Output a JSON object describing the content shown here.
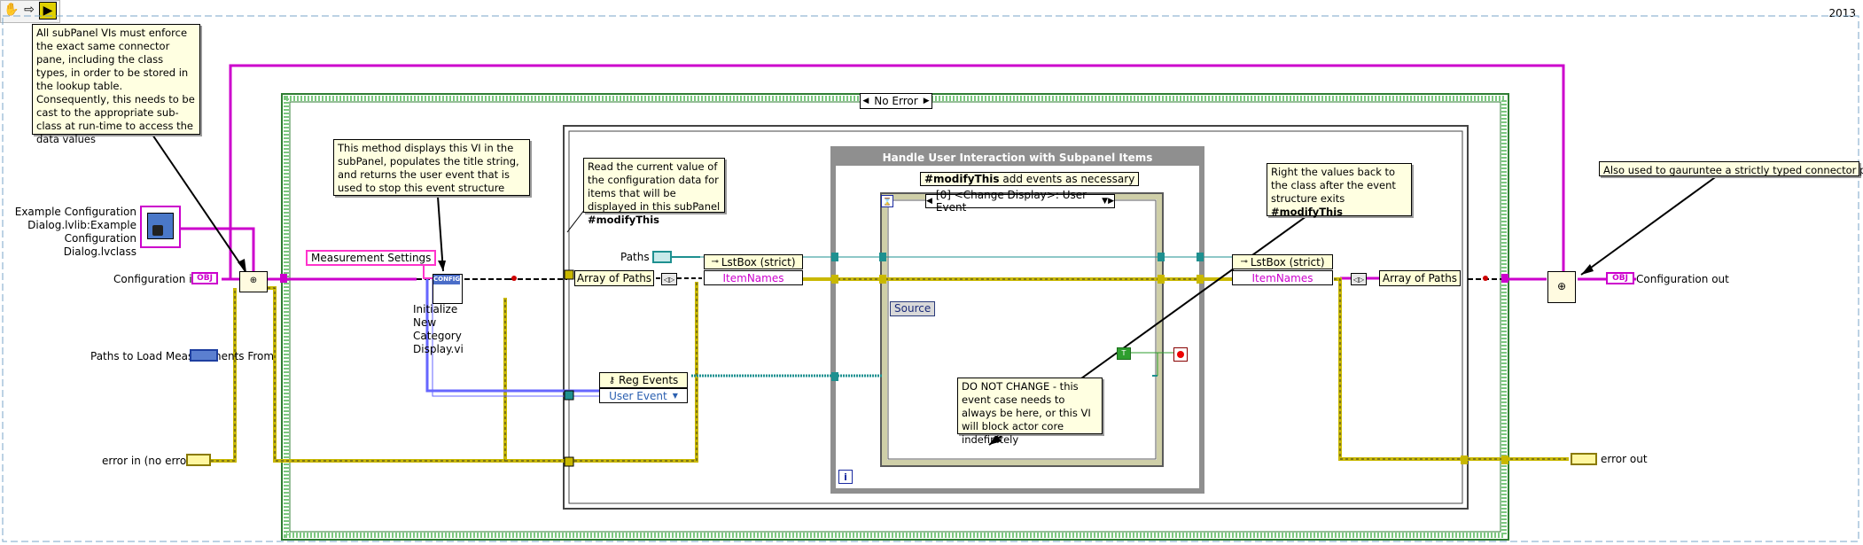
{
  "toolbar": {
    "icons": [
      "hand-icon",
      "arrow-icon",
      "run-icon"
    ]
  },
  "year": "2013",
  "notes": {
    "subpanel": "All subPanel VIs must enforce the exact same connector pane, including the class types, in order to be stored in the lookup table. Consequently, this needs to be cast to the appropriate sub-class at run-time to access the data values",
    "method_display": "This method displays this VI in the subPanel, populates the title string, and returns the user event that is used to stop this event structure when it is time to",
    "read_current_prefix": "Read the current value of the configuration data for items that will be displayed in this subPanel ",
    "read_current_tag": "#modifyThis",
    "write_back_prefix": "Right the values back to the class after the event structure exits ",
    "write_back_tag": "#modifyThis",
    "do_not_change": "DO NOT CHANGE - this event case needs to always be here, or this VI will block actor core indefinitely",
    "connector_pane": "Also used to gauruntee a strictly typed connector pane"
  },
  "labels": {
    "class_name": "Example Configuration Dialog.lvlib:Example Configuration Dialog.lvclass",
    "config_in": "Configuration in",
    "paths_to_load": "Paths to Load Measurements From",
    "error_in": "error in (no error)",
    "measurement_settings": "Measurement Settings",
    "init_vi": "Initialize New Category Display.vi",
    "paths": "Paths",
    "config_out": "Configuration out",
    "error_out": "error out"
  },
  "terminals": {
    "obj": "OBJ",
    "config_vi": "CONFIG"
  },
  "structures": {
    "case_selector": "No Error",
    "event_frame_title": "Handle User Interaction with Subpanel Items",
    "event_case_prefix": "#modifyThis",
    "event_case_suffix": " add events as necessary",
    "event_selector": "[0] <Change Display>: User Event",
    "source": "Source",
    "loop_iteration": "i"
  },
  "nodes": {
    "array_of_paths_left": "Array of Paths",
    "lstbox_left": "LstBox (strict)",
    "itemnames_left": "ItemNames",
    "reg_events": "Reg Events",
    "user_event": "User Event",
    "lstbox_right": "LstBox (strict)",
    "itemnames_right": "ItemNames",
    "array_of_paths_right": "Array of Paths"
  },
  "colors": {
    "class_wire": "#cc00cc",
    "error_wire": "#c9b800",
    "path_wire": "#1e9090",
    "event_wire": "#1e9090",
    "structure_border": "#2e7d32",
    "event_ref_wire": "#6666ff"
  }
}
